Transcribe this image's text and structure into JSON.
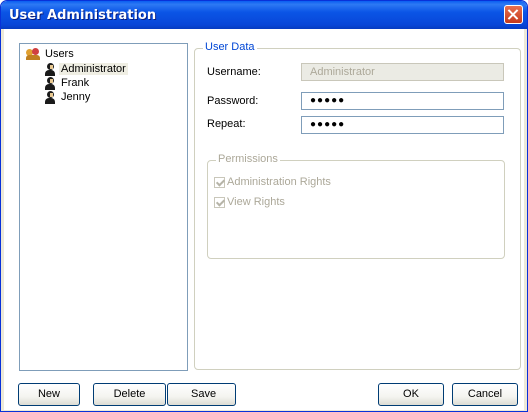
{
  "window": {
    "title": "User Administration"
  },
  "tree": {
    "root_label": "Users",
    "users": [
      "Administrator",
      "Frank",
      "Jenny"
    ],
    "selected": "Administrator"
  },
  "user_data": {
    "legend": "User Data",
    "username_label": "Username:",
    "username_value": "Administrator",
    "password_label": "Password:",
    "password_value": "●●●●●",
    "repeat_label": "Repeat:",
    "repeat_value": "●●●●●"
  },
  "permissions": {
    "legend": "Permissions",
    "items": [
      {
        "label": "Administration Rights",
        "checked": true,
        "enabled": false
      },
      {
        "label": "View Rights",
        "checked": true,
        "enabled": false
      }
    ]
  },
  "buttons": {
    "new": "New",
    "delete": "Delete",
    "save": "Save",
    "ok": "OK",
    "cancel": "Cancel"
  }
}
